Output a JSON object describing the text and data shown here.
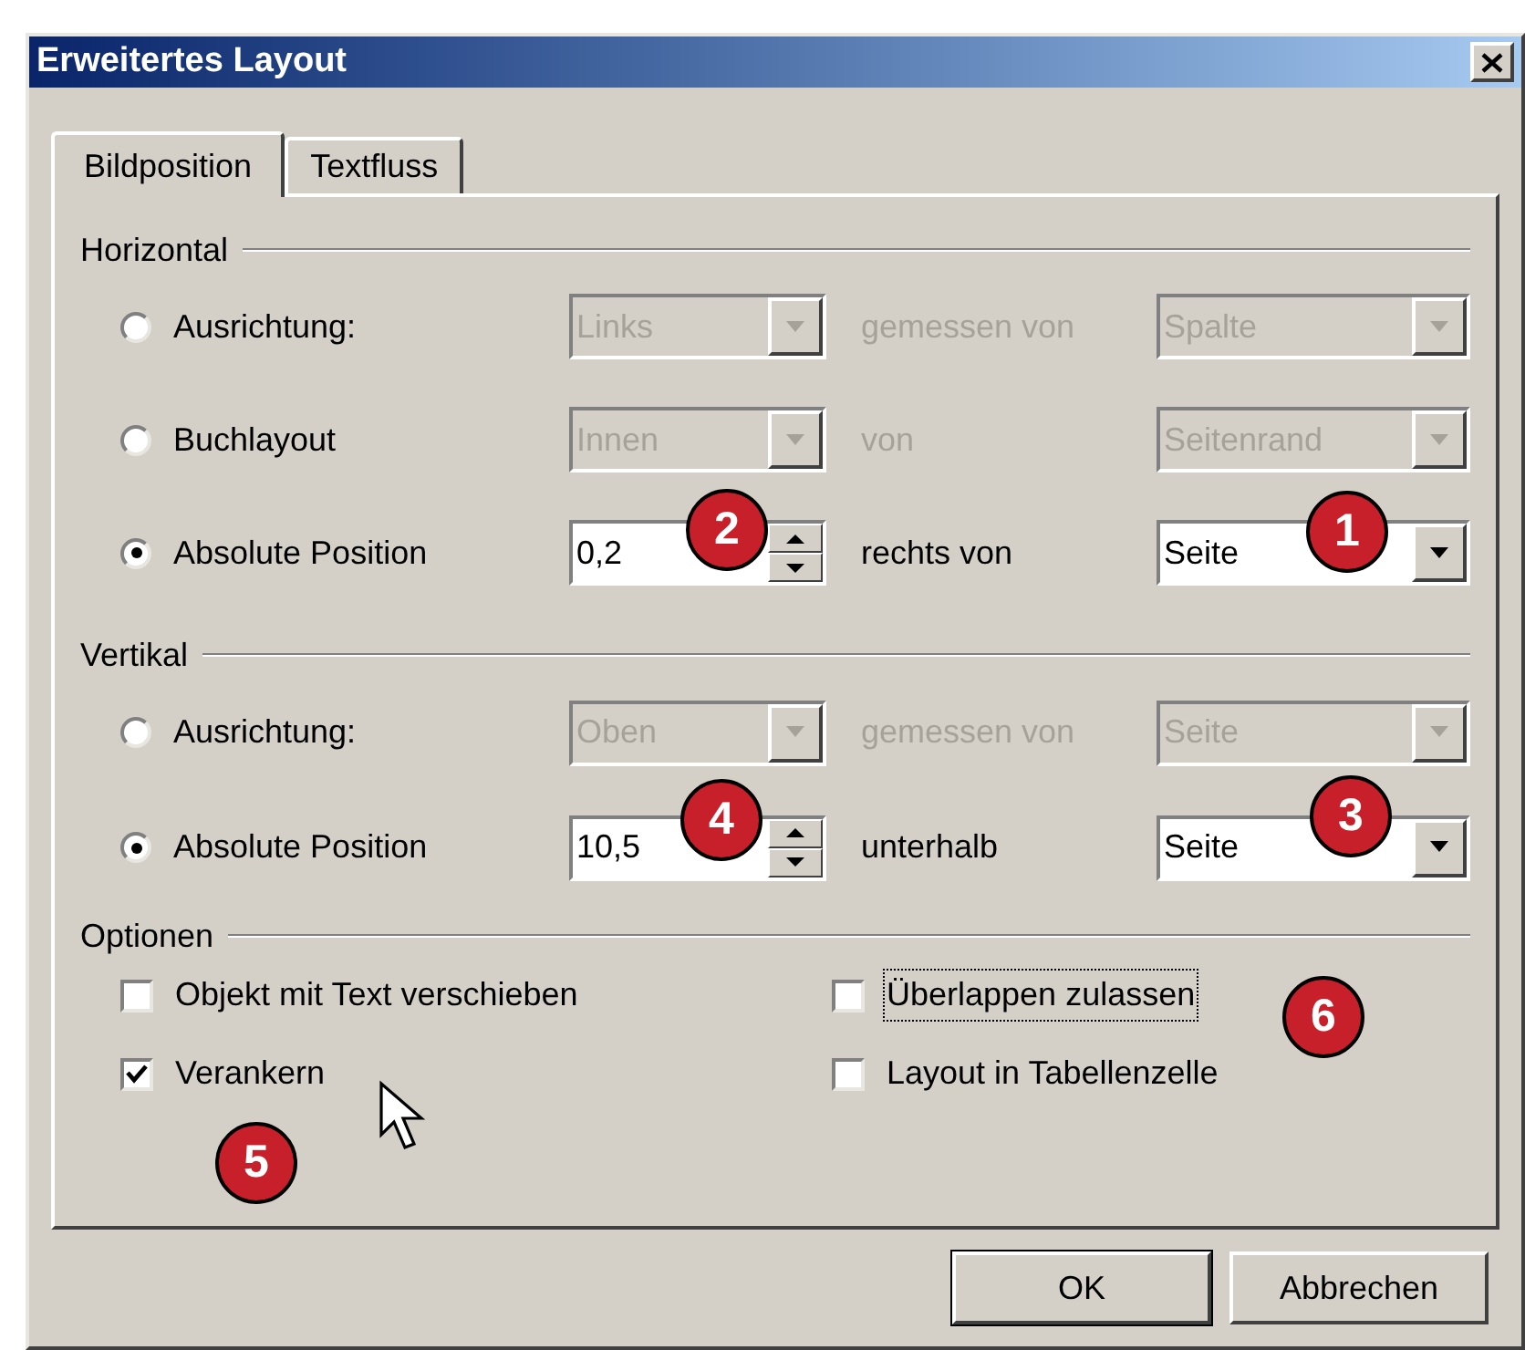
{
  "window": {
    "title": "Erweitertes Layout"
  },
  "tabs": [
    {
      "label": "Bildposition",
      "selected": true
    },
    {
      "label": "Textfluss",
      "selected": false
    }
  ],
  "sections": [
    {
      "title": "Horizontal",
      "rows": [
        {
          "label": "Ausrichtung:",
          "selected": false,
          "field": {
            "kind": "combo",
            "value": "Links",
            "disabled": true
          },
          "relation": {
            "text": "gemessen von",
            "disabled": true
          },
          "reference": {
            "value": "Spalte",
            "disabled": true
          }
        },
        {
          "label": "Buchlayout",
          "selected": false,
          "field": {
            "kind": "combo",
            "value": "Innen",
            "disabled": true
          },
          "relation": {
            "text": "von",
            "disabled": true
          },
          "reference": {
            "value": "Seitenrand",
            "disabled": true
          }
        },
        {
          "label": "Absolute Position",
          "selected": true,
          "field": {
            "kind": "spin",
            "value": "0,2"
          },
          "relation": {
            "text": "rechts von",
            "disabled": false
          },
          "reference": {
            "value": "Seite",
            "disabled": false
          }
        }
      ]
    },
    {
      "title": "Vertikal",
      "rows": [
        {
          "label": "Ausrichtung:",
          "selected": false,
          "field": {
            "kind": "combo",
            "value": "Oben",
            "disabled": true
          },
          "relation": {
            "text": "gemessen von",
            "disabled": true
          },
          "reference": {
            "value": "Seite",
            "disabled": true
          }
        },
        {
          "label": "Absolute Position",
          "selected": true,
          "field": {
            "kind": "spin",
            "value": "10,5"
          },
          "relation": {
            "text": "unterhalb",
            "disabled": false
          },
          "reference": {
            "value": "Seite",
            "disabled": false
          }
        }
      ]
    }
  ],
  "options": {
    "title": "Optionen",
    "checkboxes": [
      {
        "label": "Objekt mit Text verschieben",
        "checked": false,
        "focused": false
      },
      {
        "label": "Überlappen zulassen",
        "checked": false,
        "focused": true
      },
      {
        "label": "Verankern",
        "checked": true,
        "focused": false
      },
      {
        "label": "Layout in Tabellenzelle",
        "checked": false,
        "focused": false
      }
    ]
  },
  "buttons": [
    {
      "label": "OK",
      "default": true
    },
    {
      "label": "Abbrechen",
      "default": false
    }
  ],
  "callouts": [
    {
      "text": "1"
    },
    {
      "text": "2"
    },
    {
      "text": "3"
    },
    {
      "text": "4"
    },
    {
      "text": "5"
    },
    {
      "text": "6"
    }
  ]
}
